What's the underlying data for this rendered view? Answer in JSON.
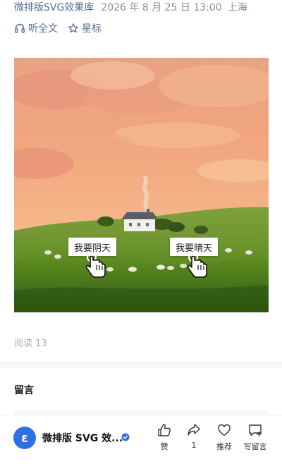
{
  "header": {
    "account_name": "微排版SVG效果库",
    "publish_time": "2026 年 8 月 25 日 13:00",
    "location": "上海",
    "listen_label": "听全文",
    "star_label": "星标"
  },
  "hero": {
    "choice_left": "我要阴天",
    "choice_right": "我要晴天"
  },
  "stats": {
    "read_count": "阅读 13"
  },
  "comments": {
    "title": "留言"
  },
  "bottom_bar": {
    "account_name": "微排版 SVG 效...",
    "avatar_glyph": "ε",
    "like_label": "赞",
    "share_count": "1",
    "recommend_label": "推荐",
    "write_comment_label": "写留言"
  },
  "colors": {
    "link_blue": "#576b95",
    "avatar_blue": "#2f6fe6",
    "meta_gray": "#8a8f99"
  },
  "icons": [
    "headphones-icon",
    "star-icon",
    "verified-badge-icon",
    "thumbs-up-icon",
    "share-icon",
    "heart-icon",
    "comment-add-icon",
    "pointing-hand-icon"
  ]
}
